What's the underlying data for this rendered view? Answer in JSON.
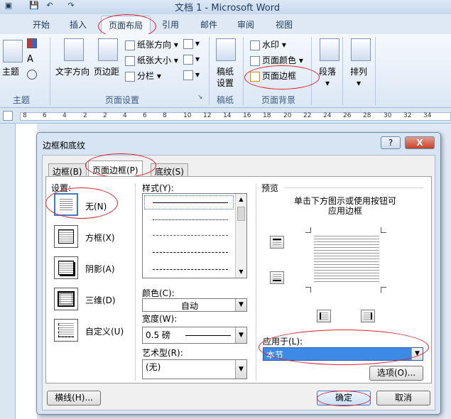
{
  "window": {
    "title": "文档 1 - Microsoft Word"
  },
  "ribbon_tabs": [
    "开始",
    "插入",
    "页面布局",
    "引用",
    "邮件",
    "审阅",
    "视图"
  ],
  "ribbon": {
    "theme_group": {
      "label": "主题",
      "button": "主题"
    },
    "page_setup_group": {
      "label": "页面设置",
      "text_direction": "文字方向",
      "margins": "页边距",
      "orientation": "纸张方向",
      "size": "纸张大小",
      "columns": "分栏"
    },
    "draft_group": {
      "label": "稿纸",
      "button_line1": "稿纸",
      "button_line2": "设置"
    },
    "background_group": {
      "label": "页面背景",
      "watermark": "水印",
      "page_color": "页面颜色",
      "page_border": "页面边框"
    },
    "paragraph": "段落",
    "arrange": "排列"
  },
  "ruler_ticks": [
    "8",
    "6",
    "4",
    "2",
    "2",
    "4",
    "6",
    "8",
    "10",
    "12",
    "14",
    "16",
    "18",
    "20",
    "22",
    "24",
    "26",
    "28",
    "30",
    "32",
    "34"
  ],
  "dialog": {
    "title": "边框和底纹",
    "help_label": "?",
    "close_label": "X",
    "tabs": [
      "边框(B)",
      "页面边框(P)",
      "底纹(S)"
    ],
    "settings": {
      "label": "设置:",
      "options": [
        "无(N)",
        "方框(X)",
        "阴影(A)",
        "三维(D)",
        "自定义(U)"
      ]
    },
    "style": {
      "label": "样式(Y):"
    },
    "color": {
      "label": "颜色(C):",
      "value": "自动"
    },
    "width": {
      "label": "宽度(W):",
      "value": "0.5 磅"
    },
    "art": {
      "label": "艺术型(R):",
      "value": "(无)"
    },
    "preview": {
      "label": "预览",
      "hint_line1": "单击下方图示或使用按钮可",
      "hint_line2": "应用边框"
    },
    "apply_to": {
      "label": "应用于(L):",
      "value": "本节"
    },
    "buttons": {
      "options": "选项(O)...",
      "horizontal_line": "横线(H)...",
      "ok": "确定",
      "cancel": "取消"
    }
  }
}
